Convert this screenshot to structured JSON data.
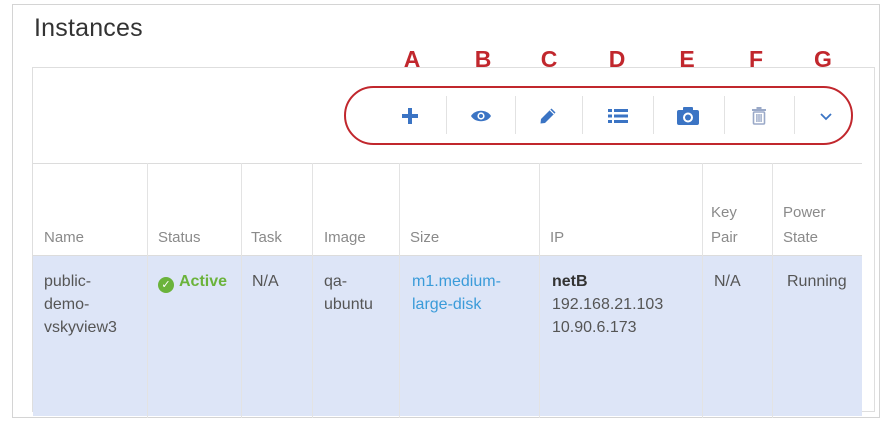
{
  "panel": {
    "title": "Instances"
  },
  "toolbar": {
    "letters": [
      "A",
      "B",
      "C",
      "D",
      "E",
      "F",
      "G"
    ],
    "buttons": [
      {
        "icon": "plus-icon",
        "glyph": "+"
      },
      {
        "icon": "eye-icon",
        "glyph": ""
      },
      {
        "icon": "pencil-icon",
        "glyph": ""
      },
      {
        "icon": "list-icon",
        "glyph": ""
      },
      {
        "icon": "camera-icon",
        "glyph": ""
      },
      {
        "icon": "trash-icon",
        "glyph": ""
      },
      {
        "icon": "chevron-down-icon",
        "glyph": ""
      }
    ],
    "icon_color": "#3b74c4",
    "trash_color": "#9aa9c8",
    "annotation_color": "#c1272d"
  },
  "table": {
    "columns": [
      {
        "line1": "",
        "line2": "Name"
      },
      {
        "line1": "",
        "line2": "Status"
      },
      {
        "line1": "",
        "line2": "Task"
      },
      {
        "line1": "",
        "line2": "Image"
      },
      {
        "line1": "",
        "line2": "Size"
      },
      {
        "line1": "",
        "line2": "IP"
      },
      {
        "line1": "Key",
        "line2": "Pair"
      },
      {
        "line1": "Power",
        "line2": "State"
      }
    ],
    "row": {
      "name": [
        "public-",
        "demo-",
        "vskyview3"
      ],
      "status": "Active",
      "task": "N/A",
      "image": [
        "qa-",
        "ubuntu"
      ],
      "size": [
        "m1.medium-",
        "large-disk"
      ],
      "ip": {
        "network": "netB",
        "addresses": [
          "192.168.21.103",
          "10.90.6.173"
        ]
      },
      "key_pair": "N/A",
      "power_state": "Running"
    },
    "row_highlight": "#dde5f7"
  }
}
